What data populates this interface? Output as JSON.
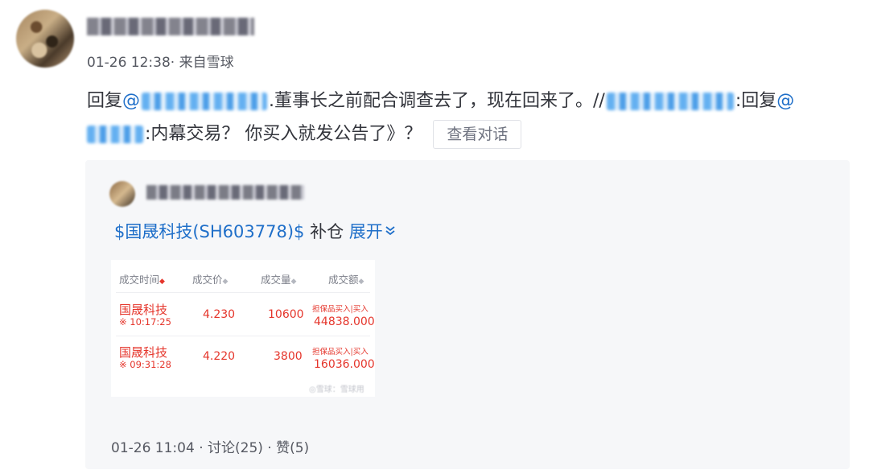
{
  "post": {
    "meta": "01-26 12:38· 来自雪球",
    "reply": {
      "line1_prefix": "回复",
      "at1": "@",
      "line1_mid": ".董事长之前配合调查去了，现在回来了。//",
      "line1_suffix": ":回复",
      "at2": "@",
      "line2_mid": ":内幕交易？ 你买入就发公告了》？"
    },
    "view_dialog_label": "查看对话"
  },
  "quote": {
    "stock_link": "$国晟科技(SH603778)$",
    "text": " 补仓 ",
    "expand_label": "展开",
    "expand_icon": "chevron-double-down-icon",
    "trade_table": {
      "headers": [
        "成交时间",
        "成交价",
        "成交量",
        "成交额"
      ],
      "rows": [
        {
          "name": "国晟科技",
          "time": "※ 10:17:25",
          "price": "4.230",
          "volume": "10600",
          "type": "担保品买入|买入",
          "amount": "44838.000"
        },
        {
          "name": "国晟科技",
          "time": "※ 09:31:28",
          "price": "4.220",
          "volume": "3800",
          "type": "担保品买入|买入",
          "amount": "16036.000"
        }
      ],
      "watermark": "◎雪球：雪球用"
    },
    "footer": "01-26 11:04  · 讨论(25) · 赞(5)"
  },
  "colors": {
    "link": "#1f6fc9",
    "trade_red": "#e5352b",
    "card_bg": "#f6f7f9"
  }
}
